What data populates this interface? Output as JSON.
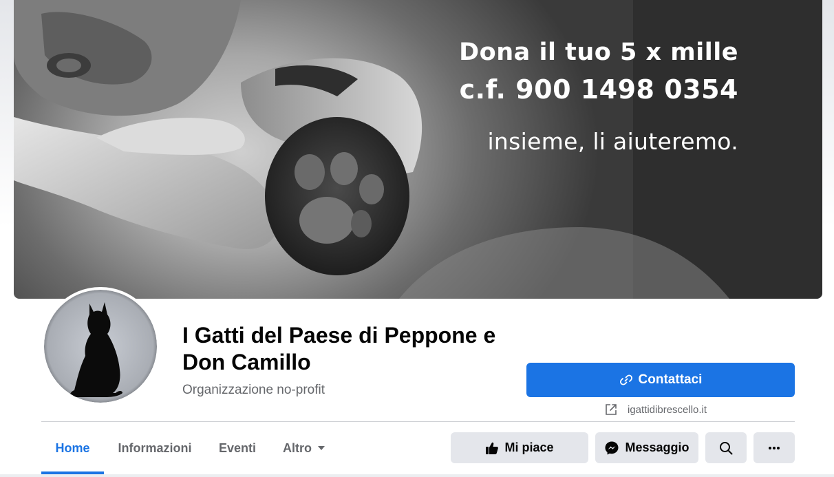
{
  "cover": {
    "line1": "Dona il tuo 5 x mille",
    "line2": "c.f. 900 1498 0354",
    "line3": "insieme, li aiuteremo."
  },
  "profile": {
    "name": "I Gatti del Paese di Peppone e Don Camillo",
    "category": "Organizzazione no-profit"
  },
  "contact": {
    "button_label": "Contattaci",
    "button_icon": "link-icon",
    "website": "igattidibrescello.it",
    "website_icon": "external-link-icon"
  },
  "tabs": [
    {
      "label": "Home",
      "active": true
    },
    {
      "label": "Informazioni",
      "active": false
    },
    {
      "label": "Eventi",
      "active": false
    },
    {
      "label": "Altro",
      "active": false,
      "icon": "caret-down-icon"
    }
  ],
  "actions": {
    "like_label": "Mi piace",
    "like_icon": "thumbs-up-icon",
    "message_label": "Messaggio",
    "message_icon": "messenger-icon",
    "search_icon": "search-icon",
    "more_icon": "more-icon"
  },
  "colors": {
    "accent": "#1b74e4",
    "secondary_button": "#e4e6eb",
    "secondary_text": "#65676b"
  }
}
